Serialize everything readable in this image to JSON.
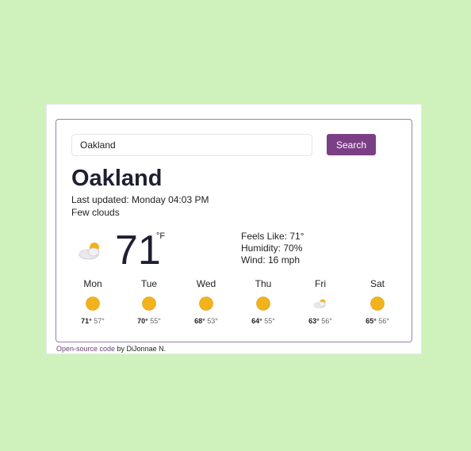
{
  "search": {
    "value": "Oakland",
    "button_label": "Search"
  },
  "current": {
    "city": "Oakland",
    "last_updated": "Last updated: Monday 04:03 PM",
    "description": "Few clouds",
    "icon": "few-clouds-icon",
    "temperature": "71",
    "unit": "°F",
    "feels_like": "Feels Like: 71°",
    "humidity": "Humidity: 70%",
    "wind": "Wind: 16 mph"
  },
  "forecast": [
    {
      "day": "Mon",
      "icon": "sun-icon",
      "high": "71°",
      "low": "57°"
    },
    {
      "day": "Tue",
      "icon": "sun-icon",
      "high": "70°",
      "low": "55°"
    },
    {
      "day": "Wed",
      "icon": "sun-icon",
      "high": "68°",
      "low": "53°"
    },
    {
      "day": "Thu",
      "icon": "sun-icon",
      "high": "64°",
      "low": "55°"
    },
    {
      "day": "Fri",
      "icon": "few-clouds-icon",
      "high": "63°",
      "low": "56°"
    },
    {
      "day": "Sat",
      "icon": "sun-icon",
      "high": "65°",
      "low": "56°"
    }
  ],
  "footer": {
    "link_text": "Open-source code",
    "suffix": " by DiJonnae N."
  },
  "colors": {
    "background": "#cff2bc",
    "accent": "#7b3f85",
    "sun": "#f2b21b"
  }
}
